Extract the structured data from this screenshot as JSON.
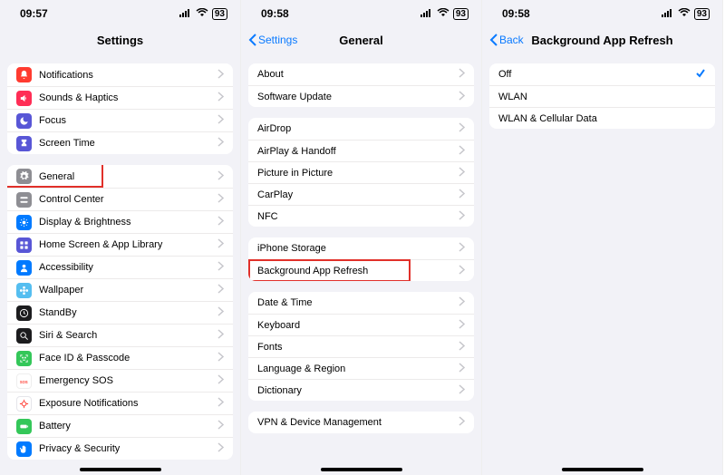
{
  "screens": [
    {
      "time": "09:57",
      "battery": "93",
      "title": "Settings",
      "back": null,
      "groups": [
        [
          {
            "icon": "bell",
            "bg": "bg-red",
            "label": "Notifications"
          },
          {
            "icon": "speaker",
            "bg": "bg-pink",
            "label": "Sounds & Haptics"
          },
          {
            "icon": "moon",
            "bg": "bg-indigo",
            "label": "Focus"
          },
          {
            "icon": "hourglass",
            "bg": "bg-indigo",
            "label": "Screen Time"
          }
        ],
        [
          {
            "icon": "gear",
            "bg": "bg-gray",
            "label": "General",
            "highlight": true
          },
          {
            "icon": "switches",
            "bg": "bg-gray",
            "label": "Control Center"
          },
          {
            "icon": "sun",
            "bg": "bg-blue",
            "label": "Display & Brightness"
          },
          {
            "icon": "grid",
            "bg": "bg-indigo",
            "label": "Home Screen & App Library"
          },
          {
            "icon": "person",
            "bg": "bg-blue",
            "label": "Accessibility"
          },
          {
            "icon": "flower",
            "bg": "bg-cyan",
            "label": "Wallpaper"
          },
          {
            "icon": "clock",
            "bg": "bg-dark",
            "label": "StandBy"
          },
          {
            "icon": "search",
            "bg": "bg-dark",
            "label": "Siri & Search"
          },
          {
            "icon": "faceid",
            "bg": "bg-green",
            "label": "Face ID & Passcode"
          },
          {
            "icon": "sos",
            "bg": "bg-sos",
            "label": "Emergency SOS"
          },
          {
            "icon": "virus",
            "bg": "bg-white",
            "label": "Exposure Notifications"
          },
          {
            "icon": "battery",
            "bg": "bg-green",
            "label": "Battery"
          },
          {
            "icon": "hand",
            "bg": "bg-blue",
            "label": "Privacy & Security"
          }
        ]
      ]
    },
    {
      "time": "09:58",
      "battery": "93",
      "title": "General",
      "back": "Settings",
      "groups": [
        [
          {
            "label": "About"
          },
          {
            "label": "Software Update"
          }
        ],
        [
          {
            "label": "AirDrop"
          },
          {
            "label": "AirPlay & Handoff"
          },
          {
            "label": "Picture in Picture"
          },
          {
            "label": "CarPlay"
          },
          {
            "label": "NFC"
          }
        ],
        [
          {
            "label": "iPhone Storage"
          },
          {
            "label": "Background App Refresh",
            "highlight": true
          }
        ],
        [
          {
            "label": "Date & Time"
          },
          {
            "label": "Keyboard"
          },
          {
            "label": "Fonts"
          },
          {
            "label": "Language & Region"
          },
          {
            "label": "Dictionary"
          }
        ],
        [
          {
            "label": "VPN & Device Management"
          }
        ]
      ]
    },
    {
      "time": "09:58",
      "battery": "93",
      "title": "Background App Refresh",
      "back": "Back",
      "groups": [
        [
          {
            "label": "Off",
            "checked": true
          },
          {
            "label": "WLAN"
          },
          {
            "label": "WLAN & Cellular Data"
          }
        ]
      ]
    }
  ]
}
